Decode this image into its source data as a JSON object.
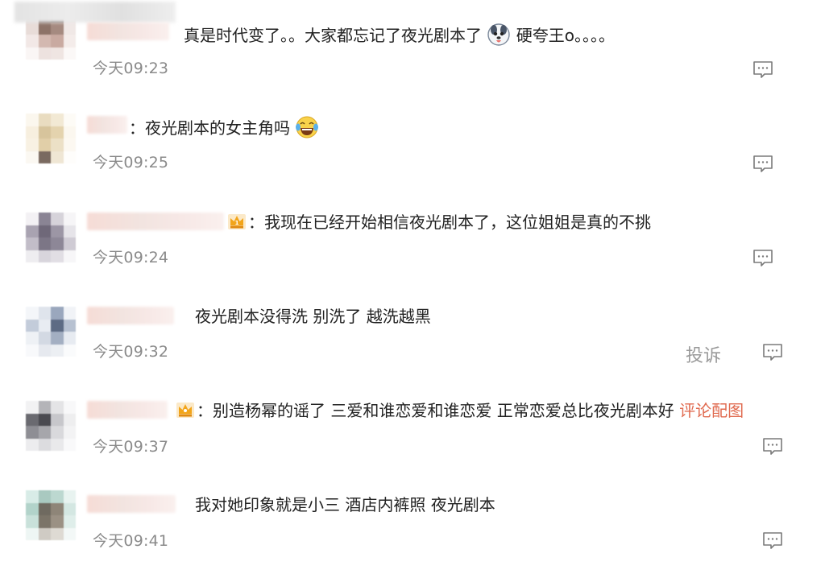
{
  "comments": [
    {
      "text": "真是时代变了。。大家都忘记了夜光剧本了",
      "suffix": "硬夸王o。。。。",
      "time": "今天09:23",
      "emoji": "dog-face-emoji"
    },
    {
      "prefix": "：",
      "text": "夜光剧本的女主角吗",
      "time": "今天09:25",
      "emoji": "laughing-tears-emoji"
    },
    {
      "prefix": "：",
      "text": "我现在已经开始相信夜光剧本了，这位姐姐是真的不挑",
      "time": "今天09:24",
      "badge": "crown-badge-icon"
    },
    {
      "text": "夜光剧本没得洗 别洗了 越洗越黑",
      "time": "今天09:32",
      "report_label": "投诉"
    },
    {
      "prefix": "：",
      "text": "别造杨幂的谣了 三爱和谁恋爱和谁恋爱 正常恋爱总比夜光剧本好",
      "link": "评论配图",
      "time": "今天09:37",
      "badge": "crown-badge-icon"
    },
    {
      "text": "我对她印象就是小三 酒店内裤照 夜光剧本",
      "time": "今天09:41"
    }
  ],
  "colors": {
    "text": "#222222",
    "time": "#8a8a8a",
    "link": "#e06a4f",
    "icon": "#7a7a7a"
  }
}
